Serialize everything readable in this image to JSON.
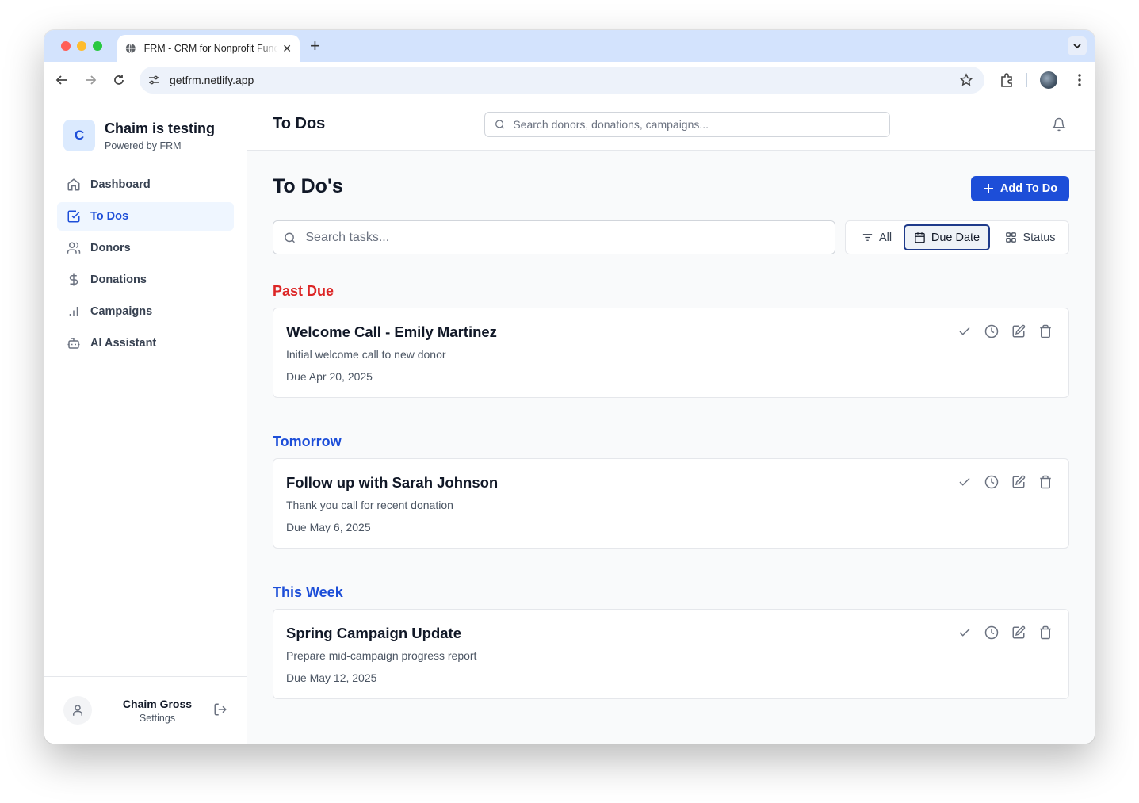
{
  "browser": {
    "tab_title": "FRM - CRM for Nonprofit Fundraising",
    "url": "getfrm.netlify.app"
  },
  "sidebar": {
    "org_initial": "C",
    "org_name": "Chaim is testing",
    "org_subtitle": "Powered by FRM",
    "items": [
      {
        "label": "Dashboard",
        "icon": "home-icon"
      },
      {
        "label": "To Dos",
        "icon": "checkbox-icon",
        "active": true
      },
      {
        "label": "Donors",
        "icon": "users-icon"
      },
      {
        "label": "Donations",
        "icon": "dollar-icon"
      },
      {
        "label": "Campaigns",
        "icon": "bar-chart-icon"
      },
      {
        "label": "AI Assistant",
        "icon": "bot-icon"
      }
    ],
    "user_name": "Chaim Gross",
    "user_link": "Settings"
  },
  "header": {
    "title": "To Dos",
    "search_placeholder": "Search donors, donations, campaigns..."
  },
  "page": {
    "title": "To Do's",
    "add_button": "Add To Do",
    "search_placeholder": "Search tasks...",
    "filters": {
      "all": "All",
      "due_date": "Due Date",
      "status": "Status",
      "selected": "Due Date"
    }
  },
  "sections": [
    {
      "heading": "Past Due",
      "color": "#dc2626",
      "tasks": [
        {
          "title": "Welcome Call - Emily Martinez",
          "description": "Initial welcome call to new donor",
          "due": "Due Apr 20, 2025"
        }
      ]
    },
    {
      "heading": "Tomorrow",
      "color": "#1d4ed8",
      "tasks": [
        {
          "title": "Follow up with Sarah Johnson",
          "description": "Thank you call for recent donation",
          "due": "Due May 6, 2025"
        }
      ]
    },
    {
      "heading": "This Week",
      "color": "#1d4ed8",
      "tasks": [
        {
          "title": "Spring Campaign Update",
          "description": "Prepare mid-campaign progress report",
          "due": "Due May 12, 2025"
        }
      ]
    }
  ],
  "colors": {
    "accent": "#1d4ed8",
    "past_due": "#dc2626"
  }
}
